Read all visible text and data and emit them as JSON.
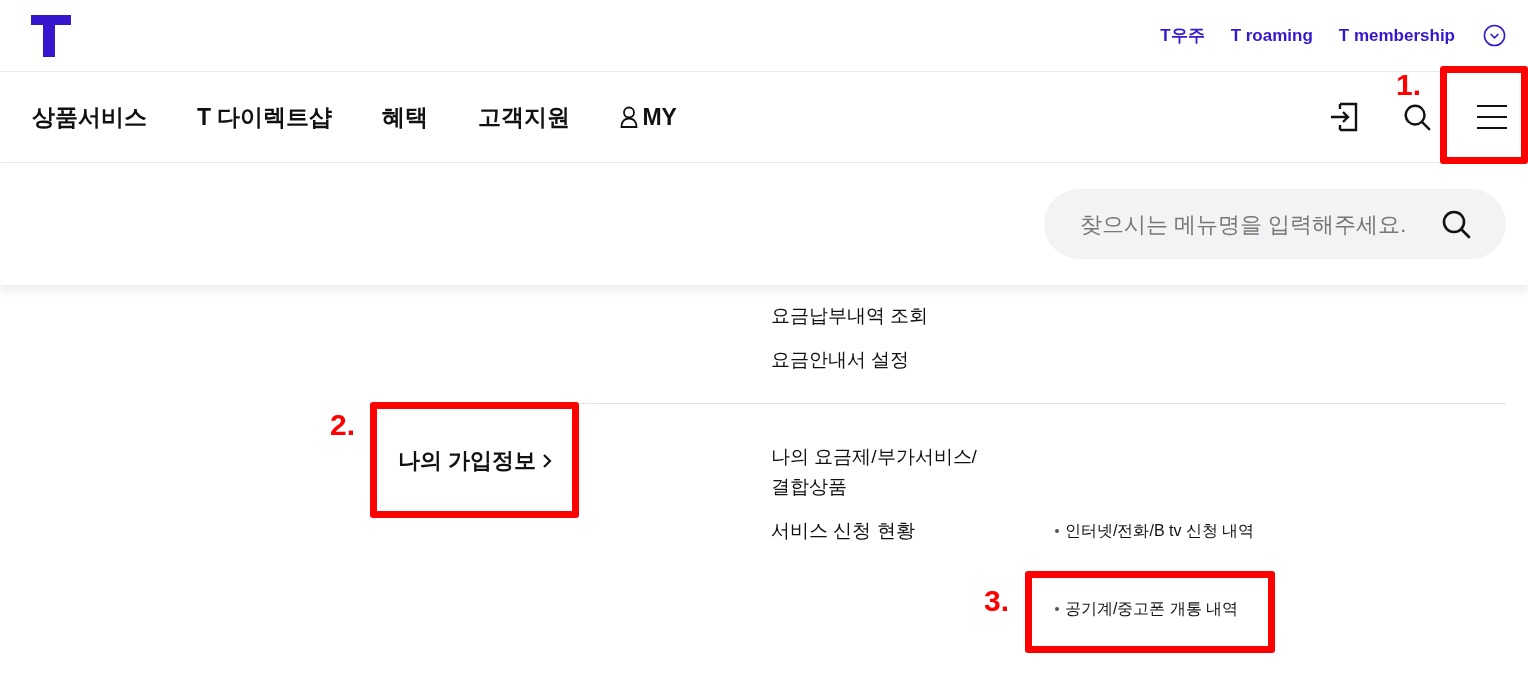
{
  "top_links": [
    {
      "label": "T우주"
    },
    {
      "label": "T roaming"
    },
    {
      "label": "T membership"
    }
  ],
  "nav": [
    {
      "label": "상품서비스",
      "kind": "text"
    },
    {
      "label": "T 다이렉트샵",
      "kind": "text"
    },
    {
      "label": "혜택",
      "kind": "text"
    },
    {
      "label": "고객지원",
      "kind": "text"
    },
    {
      "label": "MY",
      "kind": "user"
    }
  ],
  "search": {
    "placeholder": "찾으시는 메뉴명을 입력해주세요."
  },
  "menu_sections": [
    {
      "items": [
        {
          "label": "요금납부내역 조회"
        },
        {
          "label": "요금안내서 설정"
        }
      ]
    },
    {
      "title": "나의 가입정보",
      "items": [
        {
          "label": "나의 요금제/부가서비스/결합상품"
        },
        {
          "label": "서비스 신청 현황",
          "children": [
            {
              "label": "인터넷/전화/B tv 신청 내역"
            },
            {
              "label": "공기계/중고폰 개통 내역"
            }
          ]
        }
      ]
    }
  ],
  "annotations": [
    {
      "label": "1."
    },
    {
      "label": "2."
    },
    {
      "label": "3."
    }
  ]
}
